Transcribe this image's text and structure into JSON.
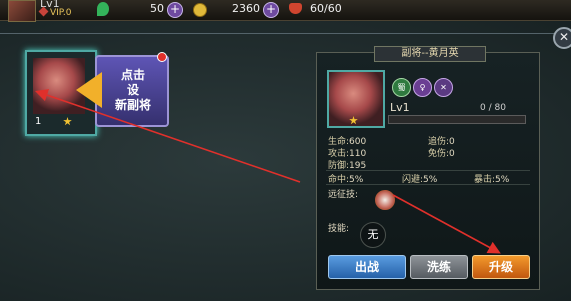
{
  "topbar": {
    "level": "Lv1",
    "vip": "VIP.0",
    "jade": "50",
    "gold": "2360",
    "stamina": "60/60",
    "plus": "+"
  },
  "formation": {
    "hero_level": "1",
    "tip_text": "点击\n设\n新副将"
  },
  "panel": {
    "title": "副将--黄月英",
    "level": "Lv1",
    "exp": "0 / 80",
    "factions": [
      "蜀",
      "♀",
      "✕"
    ],
    "stats": {
      "hp_label": "生命:",
      "hp": "600",
      "atk_label": "攻击:",
      "atk": "110",
      "def_label": "防御:",
      "def": "195",
      "chase_label": "追伤:",
      "chase": "0",
      "immune_label": "免伤:",
      "immune": "0",
      "hit_label": "命中:",
      "hit": "5%",
      "dodge_label": "闪避:",
      "dodge": "5%",
      "crit_label": "暴击:",
      "crit": "5%"
    },
    "expedition_skill_label": "远征技:",
    "skill_label": "技能:",
    "skill_none": "无",
    "buttons": {
      "battle": "出战",
      "refine": "洗练",
      "upgrade": "升级"
    }
  },
  "colors": {
    "accent_teal": "#4fa9a4",
    "button_blue": "#2561a8",
    "button_orange": "#c1570f",
    "annotation_red": "#e0302b"
  }
}
